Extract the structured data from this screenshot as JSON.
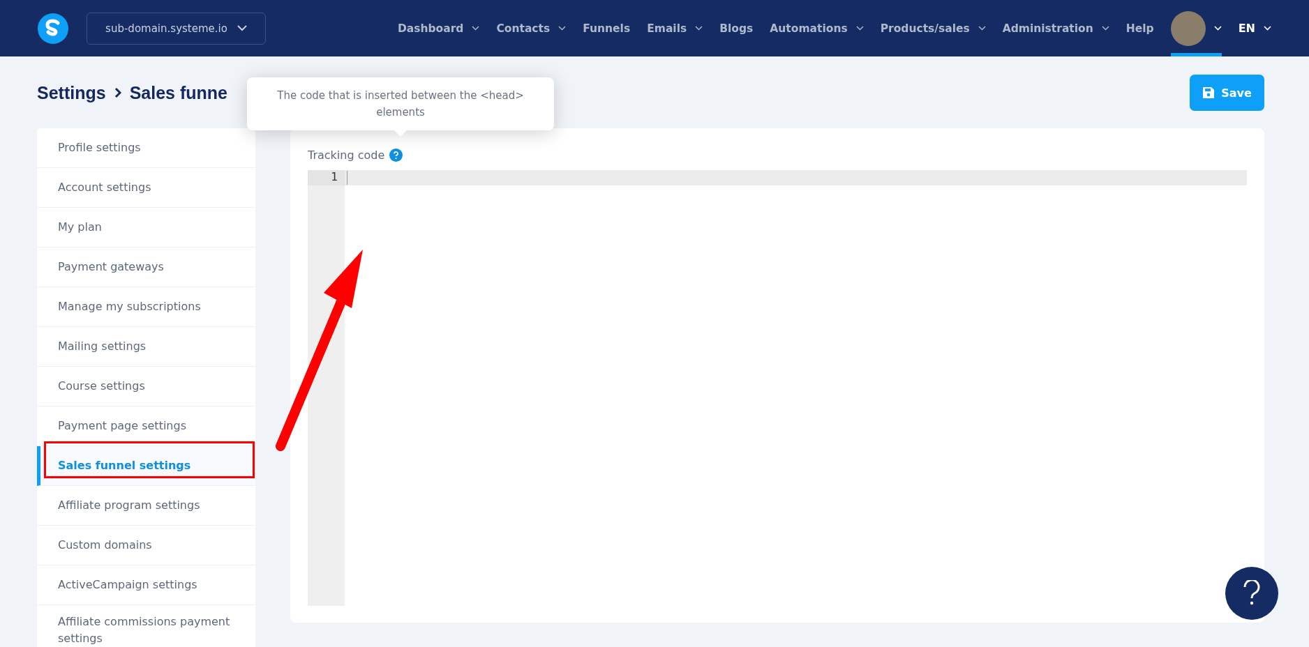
{
  "topbar": {
    "workspace": "sub-domain.systeme.io",
    "nav": [
      {
        "label": "Dashboard",
        "dropdown": true
      },
      {
        "label": "Contacts",
        "dropdown": true
      },
      {
        "label": "Funnels",
        "dropdown": false
      },
      {
        "label": "Emails",
        "dropdown": true
      },
      {
        "label": "Blogs",
        "dropdown": false
      },
      {
        "label": "Automations",
        "dropdown": true
      },
      {
        "label": "Products/sales",
        "dropdown": true
      },
      {
        "label": "Administration",
        "dropdown": true
      },
      {
        "label": "Help",
        "dropdown": false
      }
    ],
    "account": {
      "selected": true
    },
    "language": "EN"
  },
  "breadcrumb": [
    "Settings",
    "Sales funne"
  ],
  "save_button": "Save",
  "tooltip": "The code that is inserted between the <head> elements",
  "sidebar": {
    "items": [
      {
        "label": "Profile settings",
        "selected": false
      },
      {
        "label": "Account settings",
        "selected": false
      },
      {
        "label": "My plan",
        "selected": false
      },
      {
        "label": "Payment gateways",
        "selected": false
      },
      {
        "label": "Manage my subscriptions",
        "selected": false
      },
      {
        "label": "Mailing settings",
        "selected": false
      },
      {
        "label": "Course settings",
        "selected": false
      },
      {
        "label": "Payment page settings",
        "selected": false
      },
      {
        "label": "Sales funnel settings",
        "selected": true
      },
      {
        "label": "Affiliate program settings",
        "selected": false
      },
      {
        "label": "Custom domains",
        "selected": false
      },
      {
        "label": "ActiveCampaign settings",
        "selected": false
      },
      {
        "label": "Affiliate commissions payment settings",
        "selected": false
      }
    ]
  },
  "form": {
    "label": "Tracking code",
    "line_numbers": [
      "1"
    ]
  }
}
